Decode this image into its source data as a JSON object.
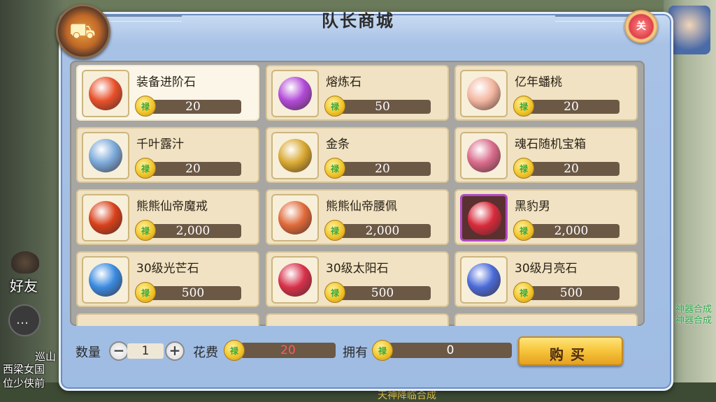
{
  "shop": {
    "title": "队长商城",
    "close_label": "关",
    "emblem_icon": "cart-emblem-icon"
  },
  "items": [
    {
      "name": "装备进阶石",
      "price": "20",
      "icon": "orange-orb-icon",
      "color": "#e8502a"
    },
    {
      "name": "熔炼石",
      "price": "50",
      "icon": "purple-orb-icon",
      "color": "#b24ad8"
    },
    {
      "name": "亿年蟠桃",
      "price": "20",
      "icon": "peach-icon",
      "color": "#f3b6a0"
    },
    {
      "name": "千叶露汁",
      "price": "20",
      "icon": "vase-icon",
      "color": "#7aa8d8"
    },
    {
      "name": "金条",
      "price": "20",
      "icon": "gold-bar-icon",
      "color": "#d8a830"
    },
    {
      "name": "魂石随机宝箱",
      "price": "20",
      "icon": "treasure-chest-icon",
      "color": "#d86a8a"
    },
    {
      "name": "熊熊仙帝魔戒",
      "price": "2,000",
      "icon": "ring-icon",
      "color": "#d8401a"
    },
    {
      "name": "熊熊仙帝腰佩",
      "price": "2,000",
      "icon": "pendant-icon",
      "color": "#e06a3a"
    },
    {
      "name": "黑豹男",
      "price": "2,000",
      "icon": "heart-icon",
      "color": "#d82a3a"
    },
    {
      "name": "30级光芒石",
      "price": "500",
      "icon": "blue-crystal-icon",
      "color": "#3a8ae0"
    },
    {
      "name": "30级太阳石",
      "price": "500",
      "icon": "red-swirl-orb-icon",
      "color": "#d8304a"
    },
    {
      "name": "30级月亮石",
      "price": "500",
      "icon": "crescent-moon-icon",
      "color": "#4a6ad8"
    }
  ],
  "footer": {
    "qty_label": "数量",
    "qty_value": "1",
    "minus": "−",
    "plus": "+",
    "cost_label": "花费",
    "cost_value": "20",
    "own_label": "拥有",
    "own_value": "0",
    "buy_label": "购买",
    "coin_glyph": "禄"
  },
  "background": {
    "friend_label": "好友",
    "chat_glyph": "…",
    "left_texts": [
      "巡山",
      "西梁女国",
      "位少侠前"
    ],
    "right_texts": [
      "神器合成",
      "神器合成"
    ],
    "bottom_text": "天神降临合成"
  }
}
